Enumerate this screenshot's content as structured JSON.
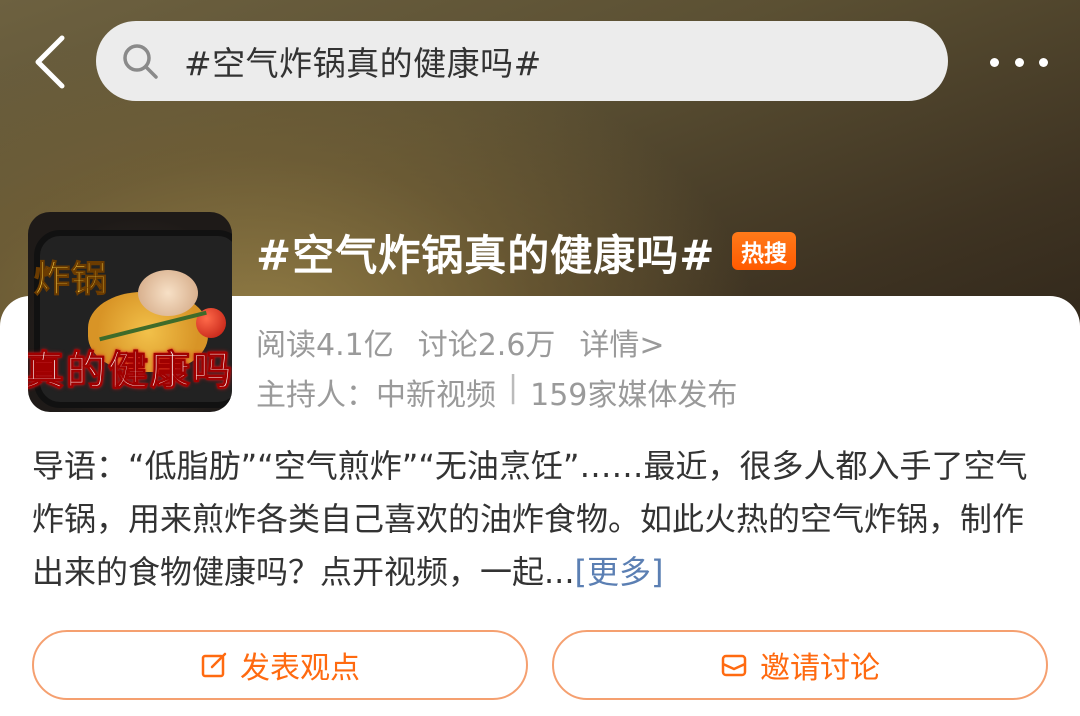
{
  "header": {
    "search_text": "#空气炸锅真的健康吗#"
  },
  "topic": {
    "title": "#空气炸锅真的健康吗#",
    "badge": "热搜",
    "cover_caption_top": "炸锅",
    "cover_caption_bottom": "真的健康吗",
    "reads": "阅读4.1亿",
    "discussions": "讨论2.6万",
    "details_link": "详情>",
    "host_label": "主持人：中新视频",
    "host_separator": "|",
    "publishers": "159家媒体发布"
  },
  "intro": {
    "text": "导语：“低脂肪”“空气煎炸”“无油烹饪”……最近，很多人都入手了空气炸锅，用来煎炸各类自己喜欢的油炸食物。如此火热的空气炸锅，制作出来的食物健康吗？点开视频，一起...",
    "more_link": "[更多]"
  },
  "actions": {
    "post_label": "发表观点",
    "invite_label": "邀请讨论"
  },
  "colors": {
    "accent": "#ff6a10",
    "badge": "#ff5a00",
    "link": "#5b7fb3"
  },
  "icons": {
    "back": "chevron-left-icon",
    "search": "search-icon",
    "more": "more-dots-icon",
    "post": "edit-icon",
    "invite": "mail-icon"
  }
}
